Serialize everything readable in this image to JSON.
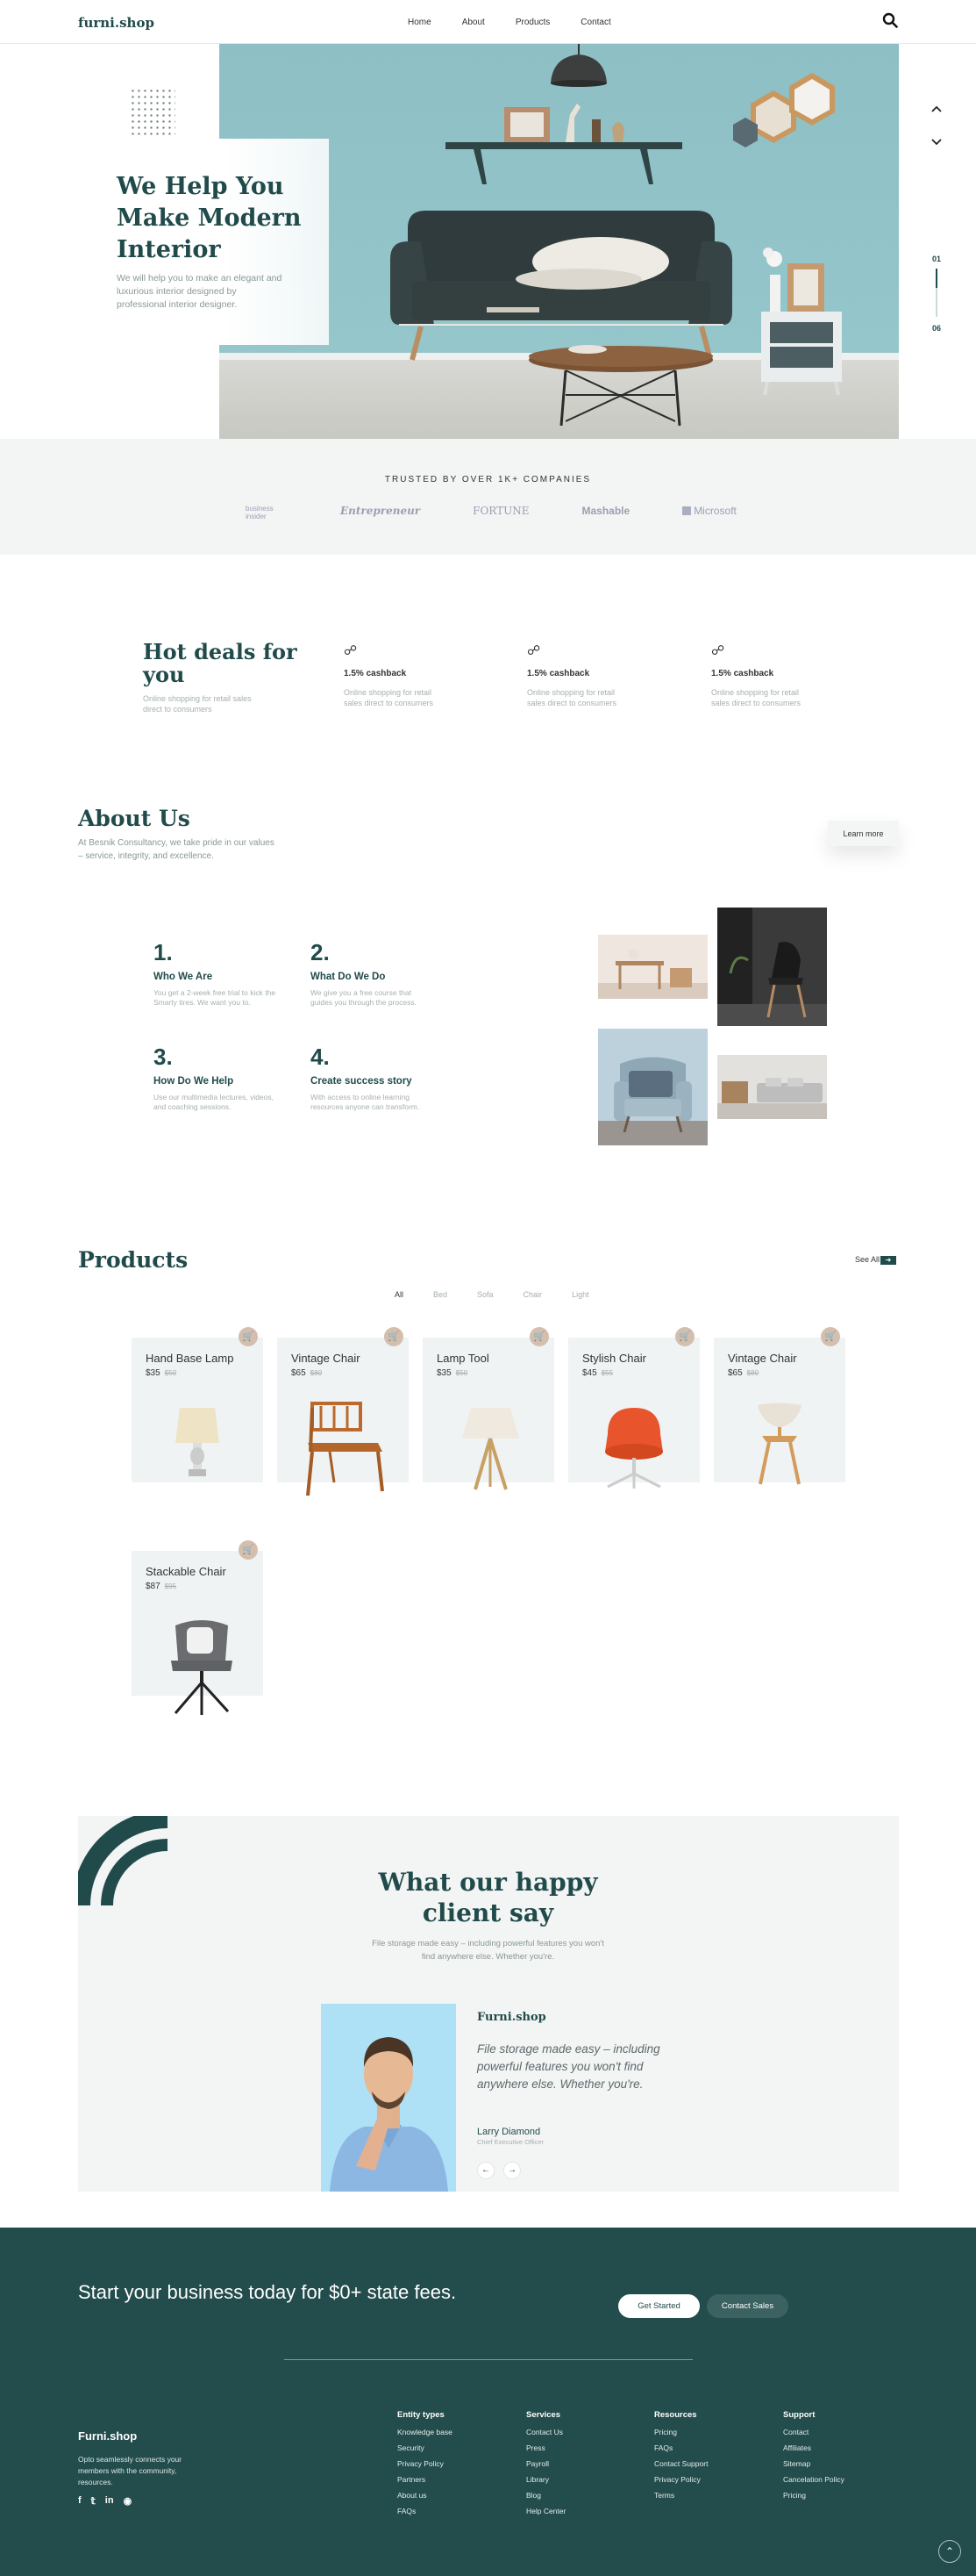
{
  "nav": {
    "logo": "furni.shop",
    "links": [
      "Home",
      "About",
      "Products",
      "Contact"
    ]
  },
  "hero": {
    "title": "We Help You Make Modern Interior",
    "subtitle": "We will help you to make an elegant and luxurious interior designed by professional interior designer.",
    "page_current": "01",
    "page_total": "06"
  },
  "trusted": {
    "title": "TRUSTED BY OVER 1K+ COMPANIES",
    "brands": [
      "business insider",
      "Entrepreneur",
      "FORTUNE",
      "Mashable",
      "Microsoft"
    ]
  },
  "deals": {
    "title": "Hot deals for you",
    "subtitle": "Online shopping for retail sales direct to consumers",
    "items": [
      {
        "title": "1.5% cashback",
        "desc": "Online shopping for retail sales direct to consumers"
      },
      {
        "title": "1.5% cashback",
        "desc": "Online shopping for retail sales direct to consumers"
      },
      {
        "title": "1.5% cashback",
        "desc": "Online shopping for retail sales direct to consumers"
      }
    ]
  },
  "about": {
    "title": "About Us",
    "subtitle": "At Besnik Consultancy, we take pride in our values – service, integrity, and excellence.",
    "learn_more": "Learn more",
    "steps": [
      {
        "num": "1.",
        "title": "Who We Are",
        "desc": "You get a 2-week free trial to kick the Smarty tires. We want you to."
      },
      {
        "num": "2.",
        "title": "What Do We Do",
        "desc": "We give you a free course that guides you through the process."
      },
      {
        "num": "3.",
        "title": "How Do We Help",
        "desc": "Use our multimedia lectures, videos, and coaching sessions."
      },
      {
        "num": "4.",
        "title": "Create success story",
        "desc": "With access to online learning resources anyone can transform."
      }
    ]
  },
  "products": {
    "title": "Products",
    "see_all": "See All",
    "filters": [
      "All",
      "Bed",
      "Sofa",
      "Chair",
      "Light"
    ],
    "active_filter": "All",
    "items": [
      {
        "name": "Hand Base Lamp",
        "price": "$35",
        "old": "$50"
      },
      {
        "name": "Vintage Chair",
        "price": "$65",
        "old": "$80"
      },
      {
        "name": "Lamp Tool",
        "price": "$35",
        "old": "$50"
      },
      {
        "name": "Stylish Chair",
        "price": "$45",
        "old": "$55"
      },
      {
        "name": "Vintage Chair",
        "price": "$65",
        "old": "$80"
      },
      {
        "name": "Stackable Chair",
        "price": "$87",
        "old": "$95"
      }
    ]
  },
  "testimonial": {
    "title": "What our happy client say",
    "subtitle": "File storage made easy – including powerful features you won't find anywhere else. Whether you're.",
    "brand": "Furni.shop",
    "quote": "File storage made easy – including powerful features you won't find anywhere else. Whether you're.",
    "name": "Larry Diamond",
    "role": "Chief Executive Officer"
  },
  "footer": {
    "cta": "Start your business today for $0+ state fees.",
    "get_started": "Get Started",
    "contact_sales": "Contact Sales",
    "brand": "Furni.shop",
    "desc": "Opto seamlessly connects your members with the community, resources.",
    "columns": [
      {
        "title": "Entity types",
        "items": [
          "Knowledge base",
          "Security",
          "Privacy Policy",
          "Partners",
          "About us",
          "FAQs"
        ]
      },
      {
        "title": "Services",
        "items": [
          "Contact Us",
          "Press",
          "Payroll",
          "Library",
          "Blog",
          "Help Center"
        ]
      },
      {
        "title": "Resources",
        "items": [
          "Pricing",
          "FAQs",
          "Contact Support",
          "Privacy Policy",
          "Terms"
        ]
      },
      {
        "title": "Support",
        "items": [
          "Contact",
          "Affiliates",
          "Sitemap",
          "Cancelation Policy",
          "Pricing"
        ]
      }
    ]
  },
  "colors": {
    "primary": "#214b4b",
    "footer": "#234c4c",
    "accent": "#d4bfae"
  }
}
